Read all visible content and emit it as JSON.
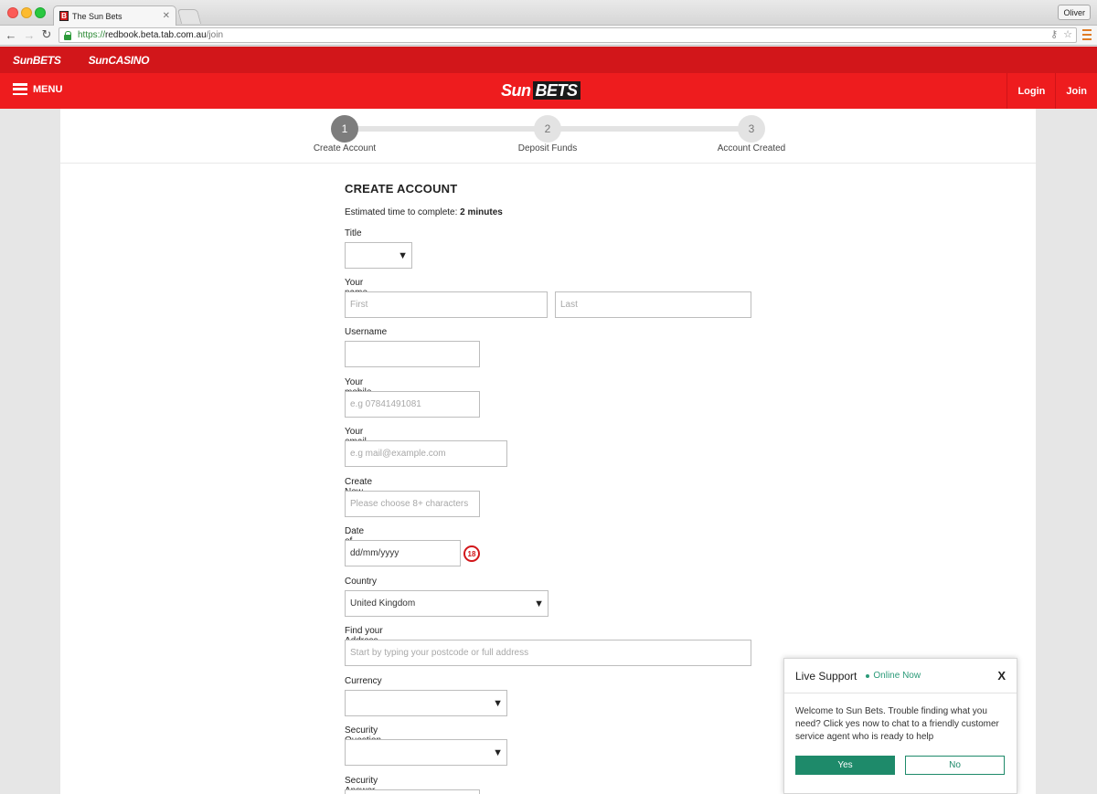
{
  "browser": {
    "tab_title": "The Sun Bets",
    "favicon_letter": "B",
    "profile_name": "Oliver",
    "url_scheme": "https://",
    "url_host": "redbook.beta.tab.com.au",
    "url_path": "/join"
  },
  "brandbar": {
    "logo_bets": "SunBETS",
    "logo_casino": "SunCASINO"
  },
  "header": {
    "menu_label": "MENU",
    "logo_sun": "Sun",
    "logo_bets": "BETS",
    "login_label": "Login",
    "join_label": "Join"
  },
  "steps": [
    {
      "number": "1",
      "label": "Create Account",
      "active": true
    },
    {
      "number": "2",
      "label": "Deposit Funds",
      "active": false
    },
    {
      "number": "3",
      "label": "Account Created",
      "active": false
    }
  ],
  "form": {
    "title": "CREATE ACCOUNT",
    "estimate_prefix": "Estimated time to complete:",
    "estimate_value": "2 minutes",
    "title_label": "Title",
    "name_label": "Your name",
    "first_placeholder": "First",
    "last_placeholder": "Last",
    "username_label": "Username",
    "mobile_label": "Your mobile",
    "mobile_placeholder": "e.g 07841491081",
    "email_label": "Your email",
    "email_placeholder": "e.g mail@example.com",
    "password_label": "Create New Password",
    "password_placeholder": "Please choose 8+ characters",
    "dob_label": "Date of Birth",
    "dob_value": "dd/mm/yyyy",
    "age_badge": "18",
    "country_label": "Country",
    "country_value": "United Kingdom",
    "address_label": "Find your Address (used for identification)",
    "address_placeholder": "Start by typing your postcode or full address",
    "currency_label": "Currency",
    "security_question_label": "Security Question",
    "security_answer_label": "Security Answer"
  },
  "support": {
    "title": "Live Support",
    "status": "Online Now",
    "close_label": "X",
    "message": "Welcome to Sun Bets. Trouble finding what you need? Click yes now to chat to a friendly customer service agent who is ready to help",
    "yes_label": "Yes",
    "no_label": "No"
  },
  "colors": {
    "brand_red": "#ee1c1e",
    "brand_dark_red": "#d2161a",
    "support_green": "#1e8a6a"
  }
}
